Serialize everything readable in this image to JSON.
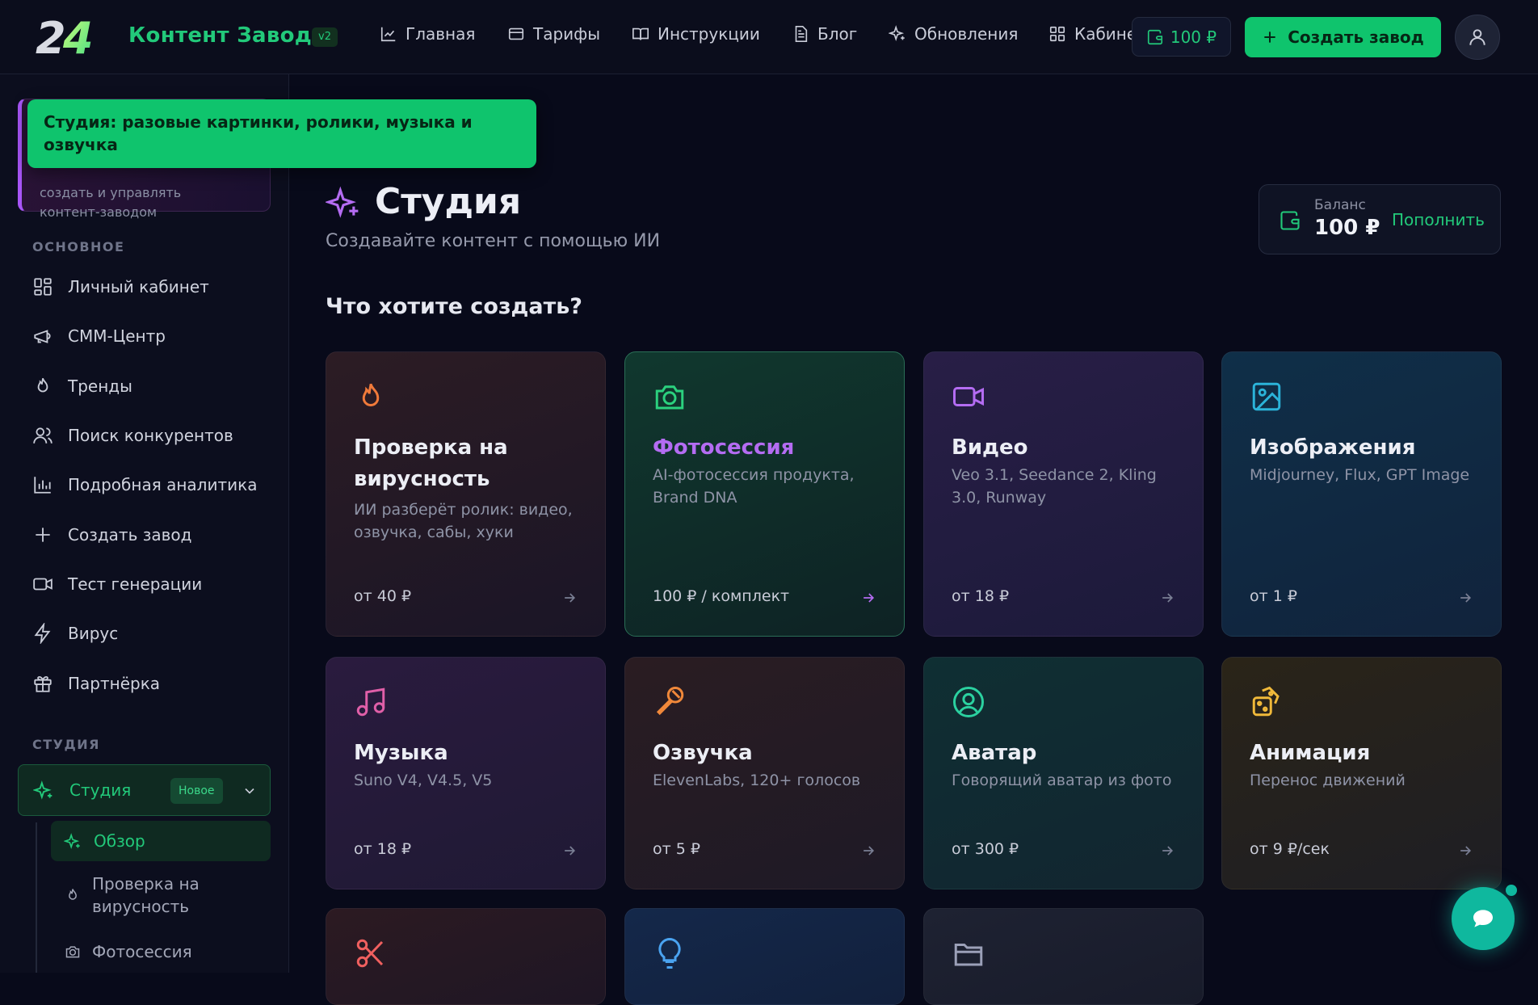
{
  "header": {
    "logo_text": "24",
    "brand": "Контент Завод",
    "version": "v2",
    "nav": [
      {
        "label": "Главная",
        "icon": "chart-icon"
      },
      {
        "label": "Тарифы",
        "icon": "card-icon"
      },
      {
        "label": "Инструкции",
        "icon": "book-icon"
      },
      {
        "label": "Блог",
        "icon": "document-icon"
      },
      {
        "label": "Обновления",
        "icon": "sparkle-icon"
      },
      {
        "label": "Кабинет",
        "icon": "grid-icon"
      }
    ],
    "wallet_amount": "100 ₽",
    "create_label": "Создать завод"
  },
  "toast": {
    "text": "Студия: разовые картинки, ролики, музыка и озвучка"
  },
  "sidebar": {
    "promo_text": "создать и управлять контент-заводом",
    "main_title": "ОСНОВНОЕ",
    "items": [
      {
        "label": "Личный кабинет",
        "icon": "grid-icon"
      },
      {
        "label": "СММ-Центр",
        "icon": "megaphone-icon"
      },
      {
        "label": "Тренды",
        "icon": "flame-icon"
      },
      {
        "label": "Поиск конкурентов",
        "icon": "users-icon"
      },
      {
        "label": "Подробная аналитика",
        "icon": "bar-chart-icon"
      },
      {
        "label": "Создать завод",
        "icon": "plus-icon"
      },
      {
        "label": "Тест генерации",
        "icon": "video-icon"
      },
      {
        "label": "Вирус",
        "icon": "bolt-icon"
      },
      {
        "label": "Партнёрка",
        "icon": "gift-icon"
      }
    ],
    "studio_title": "СТУДИЯ",
    "studio": {
      "label": "Студия",
      "badge": "Новое"
    },
    "sub_items": [
      {
        "label": "Обзор",
        "icon": "sparkle-icon"
      },
      {
        "label": "Проверка на вирусность",
        "icon": "flame-icon"
      },
      {
        "label": "Фотосессия",
        "icon": "camera-icon"
      }
    ]
  },
  "page": {
    "title": "Студия",
    "subtitle": "Создавайте контент с помощью ИИ",
    "balance_label": "Баланс",
    "balance_value": "100 ₽",
    "topup_label": "Пополнить",
    "question": "Что хотите создать?"
  },
  "cards": [
    {
      "title": "Проверка на вирусность",
      "desc": "ИИ разберёт ролик: видео, озвучка, сабы, хуки",
      "price": "от 40 ₽",
      "icon": "flame-icon",
      "accent": "#f07a3a"
    },
    {
      "title": "Фотосессия",
      "desc": "AI-фотосессия продукта, Brand DNA",
      "price": "100 ₽ / комплект",
      "icon": "camera-icon",
      "accent": "#2bd17e",
      "title_color": "#b46cf2"
    },
    {
      "title": "Видео",
      "desc": "Veo 3.1, Seedance 2, Kling 3.0, Runway",
      "price": "от 18 ₽",
      "icon": "video-icon",
      "accent": "#b46cf2"
    },
    {
      "title": "Изображения",
      "desc": "Midjourney, Flux, GPT Image",
      "price": "от 1 ₽",
      "icon": "image-icon",
      "accent": "#2bb3d9"
    },
    {
      "title": "Музыка",
      "desc": "Suno V4, V4.5, V5",
      "price": "от 18 ₽",
      "icon": "music-icon",
      "accent": "#e05fa8"
    },
    {
      "title": "Озвучка",
      "desc": "ElevenLabs, 120+ голосов",
      "price": "от 5 ₽",
      "icon": "microphone-icon",
      "accent": "#f0883a"
    },
    {
      "title": "Аватар",
      "desc": "Говорящий аватар из фото",
      "price": "от 300 ₽",
      "icon": "user-circle-icon",
      "accent": "#2bd1a0"
    },
    {
      "title": "Анимация",
      "desc": "Перенос движений",
      "price": "от 9 ₽/сек",
      "icon": "dice-icon",
      "accent": "#f0b93a"
    },
    {
      "title": "",
      "desc": "",
      "price": "",
      "icon": "scissors-icon",
      "accent": "#f0605f"
    },
    {
      "title": "",
      "desc": "",
      "price": "",
      "icon": "lightbulb-icon",
      "accent": "#4aa3f0"
    },
    {
      "title": "",
      "desc": "",
      "price": "",
      "icon": "folder-icon",
      "accent": "#9ba0b8"
    }
  ]
}
